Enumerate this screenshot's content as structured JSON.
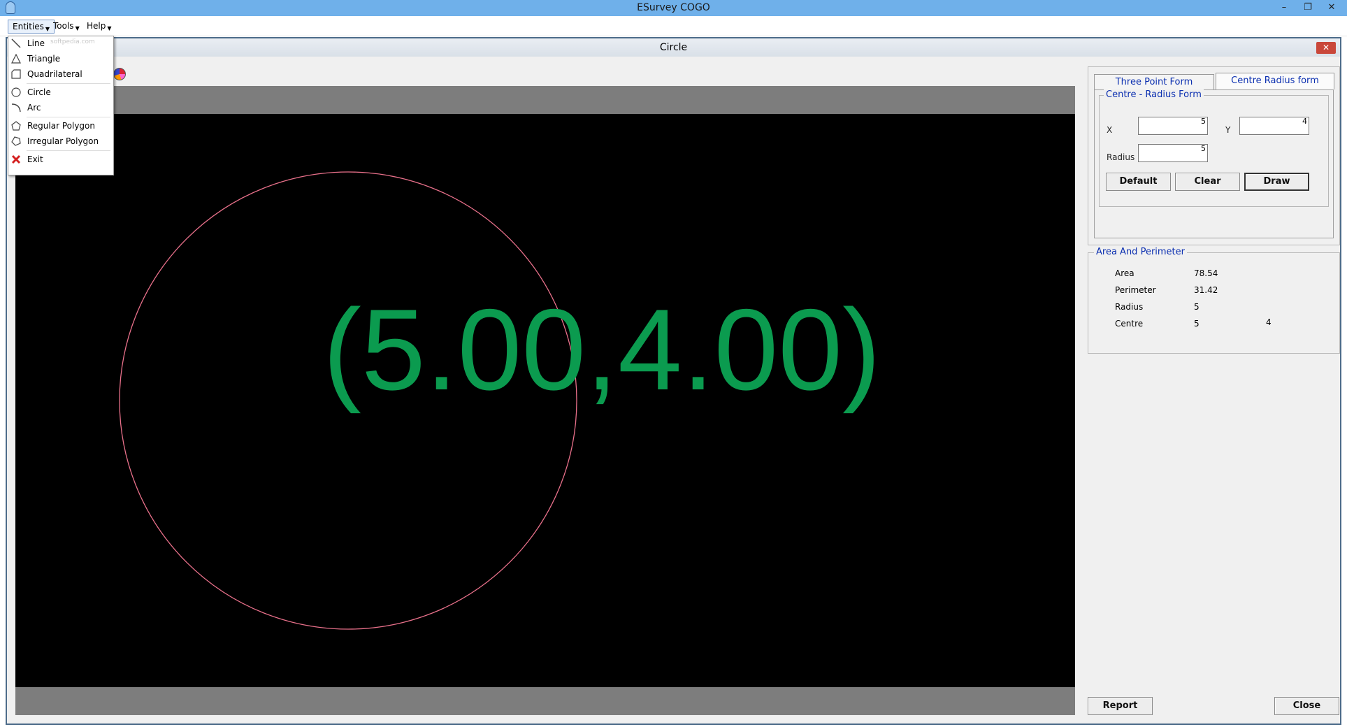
{
  "app": {
    "title": "ESurvey COGO"
  },
  "window_controls": {
    "minimize": "–",
    "restore": "❐",
    "close": "✕"
  },
  "menubar": {
    "items": [
      {
        "label": "Entities"
      },
      {
        "label": "Tools"
      },
      {
        "label": "Help"
      }
    ]
  },
  "entities_menu": {
    "watermark": "softpedia.com",
    "items": [
      {
        "label": "Line",
        "icon": "line-icon"
      },
      {
        "label": "Triangle",
        "icon": "triangle-icon"
      },
      {
        "label": "Quadrilateral",
        "icon": "quadrilateral-icon"
      },
      {
        "label": "Circle",
        "icon": "circle-icon"
      },
      {
        "label": "Arc",
        "icon": "arc-icon"
      },
      {
        "label": "Regular Polygon",
        "icon": "regular-polygon-icon"
      },
      {
        "label": "Irregular Polygon",
        "icon": "irregular-polygon-icon"
      },
      {
        "label": "Exit",
        "icon": "exit-icon"
      }
    ]
  },
  "child_window": {
    "title": "Circle",
    "close": "✕"
  },
  "canvas": {
    "background": "#000000",
    "circle_color": "#e8708a",
    "label": "(5.00,4.00)",
    "label_color": "#0b9b4f"
  },
  "tabs": [
    {
      "label": "Three Point Form",
      "active": false
    },
    {
      "label": "Centre Radius form",
      "active": true
    }
  ],
  "centre_radius_form": {
    "legend": "Centre - Radius Form",
    "x_label": "X",
    "x_value": "5",
    "y_label": "Y",
    "y_value": "4",
    "radius_label": "Radius",
    "radius_value": "5",
    "default_button": "Default",
    "clear_button": "Clear",
    "draw_button": "Draw"
  },
  "area_perimeter": {
    "legend": "Area And Perimeter",
    "area_label": "Area",
    "area_value": "78.54",
    "perimeter_label": "Perimeter",
    "perimeter_value": "31.42",
    "radius_label": "Radius",
    "radius_value": "5",
    "centre_label": "Centre",
    "centre_x": "5",
    "centre_y": "4"
  },
  "footer": {
    "report_button": "Report",
    "close_button": "Close"
  }
}
